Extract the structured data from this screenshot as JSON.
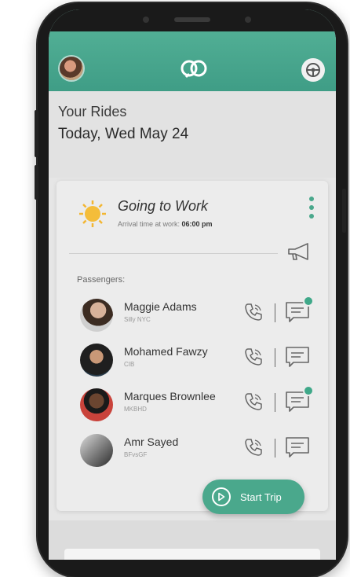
{
  "app": {
    "accent": "#4aa88c",
    "topbar_color": "#58b59a"
  },
  "header": {
    "title": "Your Rides",
    "date": "Today, Wed May 24"
  },
  "trip": {
    "title": "Going to Work",
    "arrival_label": "Arrival time at work:",
    "arrival_time": "06:00 pm",
    "icon": "sun-icon"
  },
  "passengers": {
    "label": "Passengers:",
    "list": [
      {
        "name": "Maggie Adams",
        "sub": "Silly NYC",
        "unread": true
      },
      {
        "name": "Mohamed Fawzy",
        "sub": "CIB",
        "unread": false
      },
      {
        "name": "Marques Brownlee",
        "sub": "MKBHD",
        "unread": true
      },
      {
        "name": "Amr Sayed",
        "sub": "BFvsGF",
        "unread": false
      }
    ]
  },
  "actions": {
    "start_trip": "Start Trip"
  }
}
